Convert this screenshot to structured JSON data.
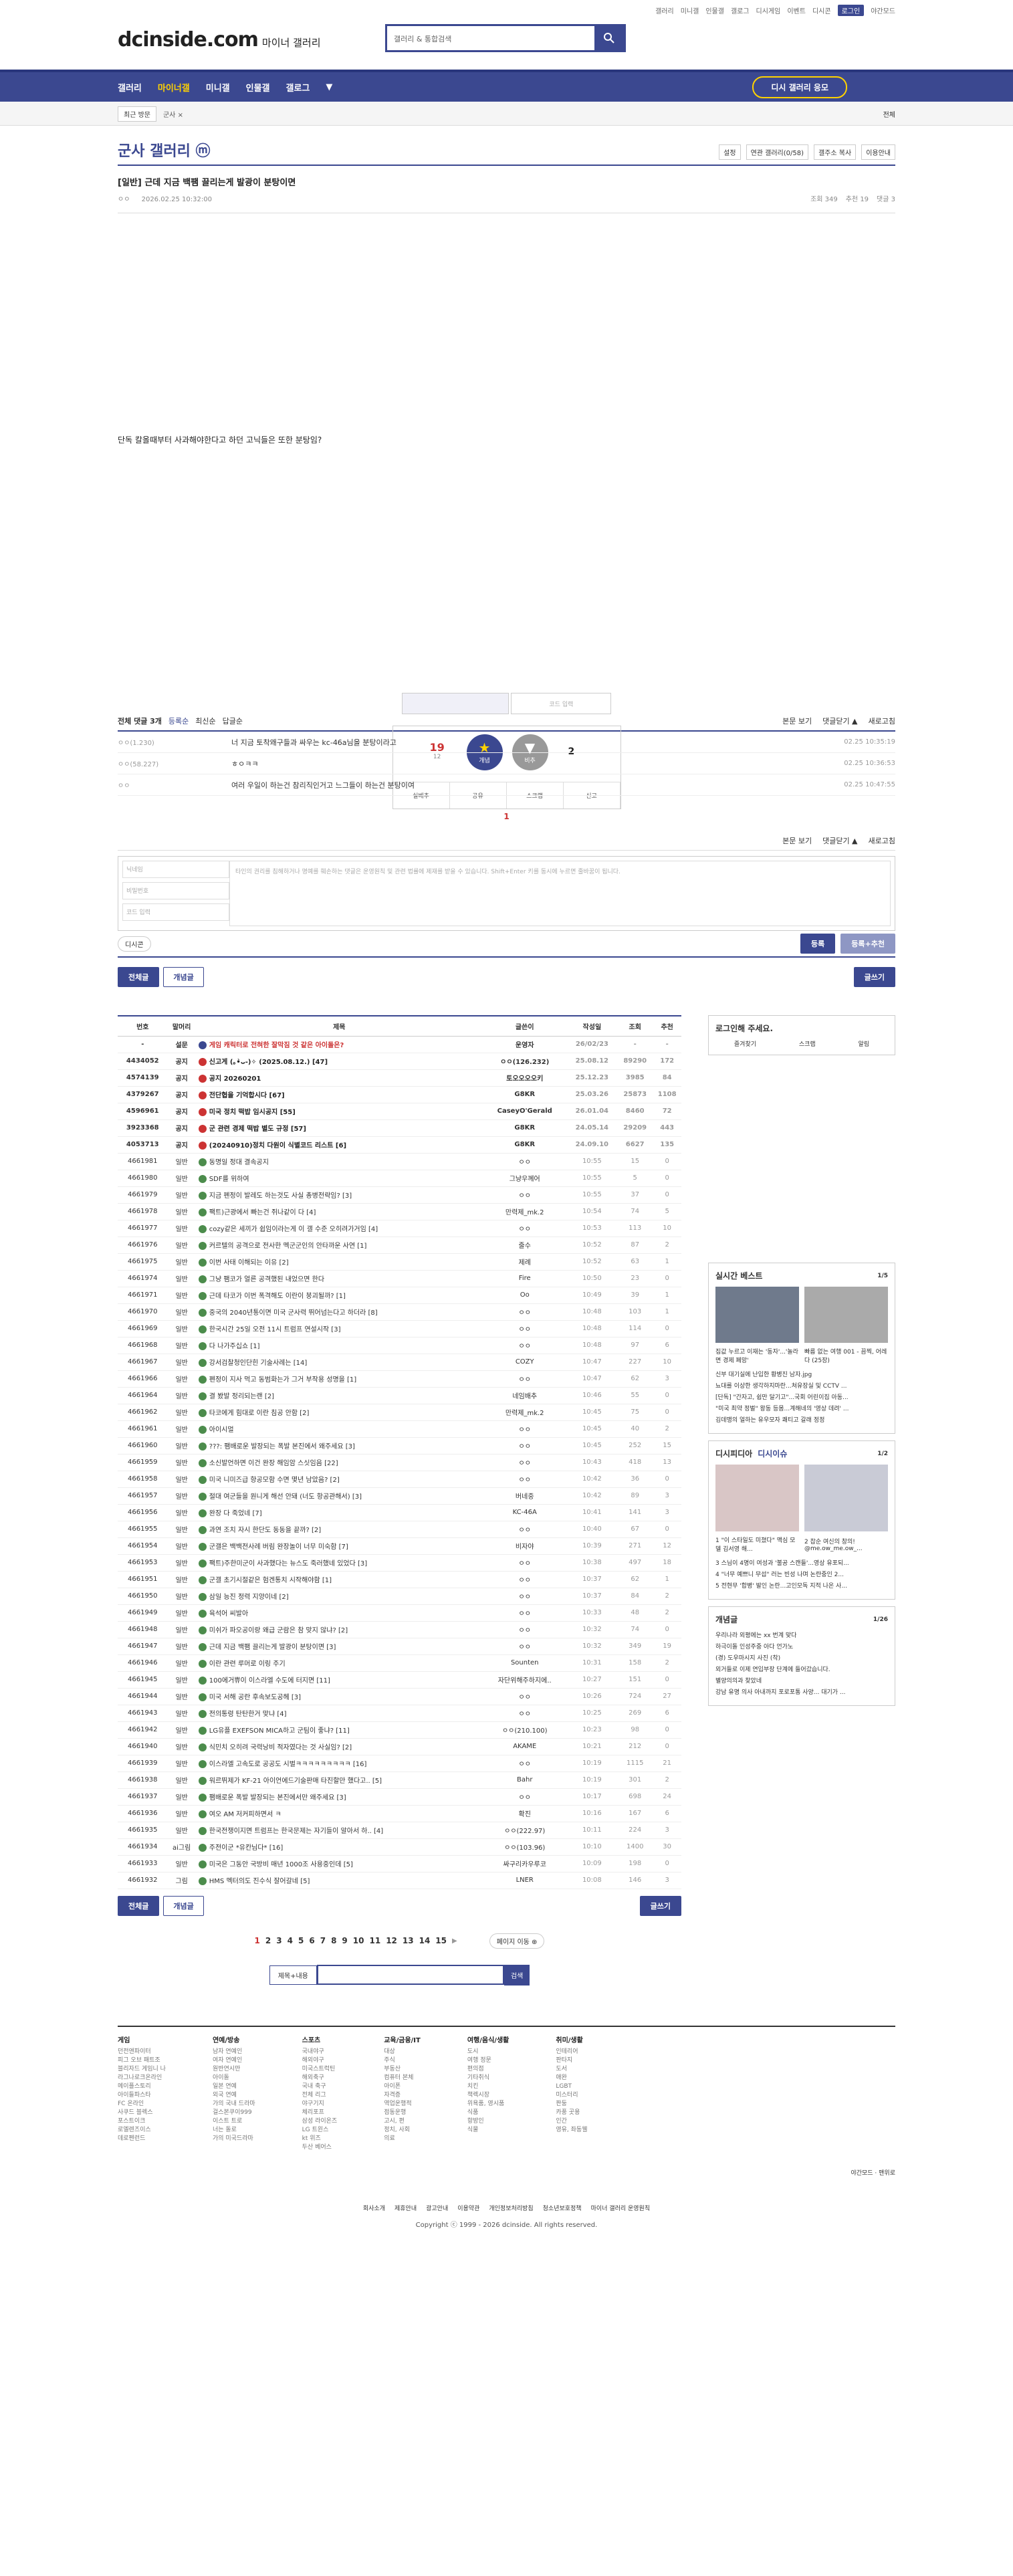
{
  "util_links": [
    "갤러리",
    "미니갤",
    "인물갤",
    "갤로그",
    "디시게임",
    "이벤트",
    "디시콘",
    "로그인",
    "야간모드"
  ],
  "header": {
    "logo": "dcinside.com",
    "logo_sub": "마이너 갤러리",
    "search_placeholder": "갤러리 & 통합검색"
  },
  "nav": {
    "items": [
      "갤러리",
      "마이너갤",
      "미니갤",
      "인물갤",
      "갤로그"
    ],
    "cta": "디시 갤러리 응모"
  },
  "recent": {
    "label": "최근 방문",
    "item": "군사 ×",
    "all": "전체"
  },
  "gallery": {
    "title": "군사 갤러리 ⓜ",
    "tools": [
      "설정",
      "연관 갤러리(0/58)",
      "갤주소 복사",
      "이용안내"
    ]
  },
  "post": {
    "title": "[일반] 근데 지금 백팸 끌리는게 발광이 분탕이면",
    "author": "ㅇㅇ",
    "date": "2026.02.25 10:32:00",
    "views": "조회 349",
    "reco": "추천 19",
    "comments": "댓글 3",
    "body": "단독 칼올때부터 사과해야한다고 하던 고닉들은 또한 분탕임?",
    "captcha_ph": "코드 입력",
    "up": "19",
    "up_fix": "12",
    "down": "2",
    "up_label": "개념",
    "down_label": "비추",
    "fn": [
      "실베추",
      "공유",
      "스크랩",
      "신고"
    ]
  },
  "comment": {
    "count": "전체 댓글 3개",
    "sort": [
      "등록순",
      "최신순",
      "답글순"
    ],
    "view": "본문 보기",
    "fold": "댓글닫기 ▲",
    "refresh": "새로고침",
    "list": [
      {
        "user": "ㅇㅇ(1.230)",
        "text": "너 지금 토착왜구들과 싸우는 kc-46a님을 분탕이라고",
        "time": "02.25 10:35:19"
      },
      {
        "user": "ㅇㅇ(58.227)",
        "text": "ㅎㅇㅋㅋ",
        "time": "02.25 10:36:53"
      },
      {
        "user": "ㅇㅇ",
        "text": "여러 우일이 하는건 참리직인거고 느그들이 하는건 분탕이여",
        "time": "02.25 10:47:55"
      }
    ],
    "page": "1",
    "nick_ph": "닉네임",
    "pw_ph": "비밀번호",
    "code_ph": "코드 입력",
    "text_ph": "타인의 권리를 침해하거나 명예를 훼손하는 댓글은 운영원칙 및 관련 법률에 제재를 받을 수 있습니다. Shift+Enter 키를 동시에 누르면 줄바꿈이 됩니다.",
    "dicon": "디시콘",
    "submit": "등록",
    "submit_reco": "등록+추천"
  },
  "list_tabs": {
    "all": "전체글",
    "concept": "개념글",
    "write": "글쓰기"
  },
  "table": {
    "cols": [
      "번호",
      "말머리",
      "제목",
      "글쓴이",
      "작성일",
      "조회",
      "추천"
    ],
    "rows": [
      [
        "-",
        "설문",
        "게임 캐릭터로 전혀한 잘막짐 것 같은 아이돌은?",
        "운영자",
        "26/02/23",
        "-",
        "-"
      ],
      [
        "4434052",
        "공지",
        "신고게 (｡•̀ᴗ-)✧ (2025.08.12.) [47]",
        "ㅇㅇ(126.232)",
        "25.08.12",
        "89290",
        "172"
      ],
      [
        "4574139",
        "공지",
        "공지 20260201",
        "토오오오오키",
        "25.12.23",
        "3985",
        "84"
      ],
      [
        "4379267",
        "공지",
        "전단협을 기억합시다 [67]",
        "G8KR",
        "25.03.26",
        "25873",
        "1108"
      ],
      [
        "4596961",
        "공지",
        "미국 정치 떡밥 임시공지 [55]",
        "CaseyO'Gerald",
        "26.01.04",
        "8460",
        "72"
      ],
      [
        "3923368",
        "공지",
        "군 관련 경제 떡밥 별도 규정 [57]",
        "G8KR",
        "24.05.14",
        "29209",
        "443"
      ],
      [
        "4053713",
        "공지",
        "(20240910)정치 다원이 식별코드 리스트 [6]",
        "G8KR",
        "24.09.10",
        "6627",
        "135"
      ],
      [
        "4661981",
        "일반",
        "동명일 정대 결속공지",
        "ㅇㅇ",
        "10:55",
        "15",
        "0"
      ],
      [
        "4661980",
        "일반",
        "SDF를 위하여",
        "그냥우께어",
        "10:55",
        "5",
        "0"
      ],
      [
        "4661979",
        "일반",
        "지금 펜정이 발레도 하는것도 사실 총병전략임? [3]",
        "ㅇㅇ",
        "10:55",
        "37",
        "0"
      ],
      [
        "4661978",
        "일반",
        "팩트)근광에서 빠는건 쥐나같이 다 [4]",
        "만력제_mk.2",
        "10:54",
        "74",
        "5"
      ],
      [
        "4661977",
        "일반",
        "cozy같은 세끼가 쉽임이라는게 이 갤 수준 오히려가거임 [4]",
        "ㅇㅇ",
        "10:53",
        "113",
        "10"
      ],
      [
        "4661976",
        "일반",
        "커르텔의 공격으로 전사한 멕군군인의 안타까운 사연 [1]",
        "줄수",
        "10:52",
        "87",
        "2"
      ],
      [
        "4661975",
        "일반",
        "이번 사태 이해되는 이유 [2]",
        "제례",
        "10:52",
        "63",
        "1"
      ],
      [
        "4661974",
        "일반",
        "그냥 팸코가 얼른 공격했된 내었으면 한다",
        "Fire",
        "10:50",
        "23",
        "0"
      ],
      [
        "4661971",
        "일반",
        "근데 타코가 이번 폭격해도 이란이 붕괴될까? [1]",
        "Oo",
        "10:49",
        "39",
        "1"
      ],
      [
        "4661970",
        "일반",
        "중국의 2040년통이면 미국 군사력 뛰어넘는다고 하더라 [8]",
        "ㅇㅇ",
        "10:48",
        "103",
        "1"
      ],
      [
        "4661969",
        "일반",
        "한국시간 25일 오전 11시 트럼프 연설시작 [3]",
        "ㅇㅇ",
        "10:48",
        "114",
        "0"
      ],
      [
        "4661968",
        "일반",
        "다 나가주십쇼 [1]",
        "ㅇㅇ",
        "10:48",
        "97",
        "6"
      ],
      [
        "4661967",
        "일반",
        "강서검찰청인단힌 기술사례는 [14]",
        "COZY",
        "10:47",
        "227",
        "10"
      ],
      [
        "4661966",
        "일반",
        "펜정이 지사 먹고 동범화는가 그거 부작용 성명을 [1]",
        "ㅇㅇ",
        "10:47",
        "62",
        "3"
      ],
      [
        "4661964",
        "일반",
        "결 봤발 정리되는랜 [2]",
        "네임배추",
        "10:46",
        "55",
        "0"
      ],
      [
        "4661962",
        "일반",
        "타코에게 힘대로 이란 침공 안함 [2]",
        "만력제_mk.2",
        "10:45",
        "75",
        "0"
      ],
      [
        "4661961",
        "일반",
        "아이시멀",
        "ㅇㅇ",
        "10:45",
        "40",
        "2"
      ],
      [
        "4661960",
        "일반",
        "???: 팸배로운 발장되는 폭발 본진에서 왜주세요 [3]",
        "ㅇㅇ",
        "10:45",
        "252",
        "15"
      ],
      [
        "4661959",
        "일반",
        "소신발언하면 이건 완장 해임암 스싯임음 [22]",
        "ㅇㅇ",
        "10:43",
        "418",
        "13"
      ],
      [
        "4661958",
        "일반",
        "미국 니미즈급 항공모함 수면 몇년 남았음? [2]",
        "ㅇㅇ",
        "10:42",
        "36",
        "0"
      ],
      [
        "4661957",
        "일반",
        "절대 여군들을 원니게 해선 안돼 (너도 항공관해서) [3]",
        "버네중",
        "10:42",
        "89",
        "3"
      ],
      [
        "4661956",
        "일반",
        "완장 다 죽었네 [7]",
        "KC-46A",
        "10:41",
        "141",
        "3"
      ],
      [
        "4661955",
        "일반",
        "과연 조치 자시 한단도 동동을 끝까? [2]",
        "ㅇㅇ",
        "10:40",
        "67",
        "0"
      ],
      [
        "4661954",
        "일반",
        "군갤은 백백전사례 버림 완장놀이 너무 미숙함 [7]",
        "비자야",
        "10:39",
        "271",
        "12"
      ],
      [
        "4661953",
        "일반",
        "팩트)주한미군이 사과했다는 뉴스도 죽러했네 있었다 [3]",
        "ㅇㅇ",
        "10:38",
        "497",
        "18"
      ],
      [
        "4661951",
        "일반",
        "군갤 초기시절같은 험겐통치 시작해야함 [1]",
        "ㅇㅇ",
        "10:37",
        "62",
        "1"
      ],
      [
        "4661950",
        "일반",
        "삼일 능진 정력 지양이네 [2]",
        "ㅇㅇ",
        "10:37",
        "84",
        "2"
      ],
      [
        "4661949",
        "일반",
        "육석어 씨발아",
        "ㅇㅇ",
        "10:33",
        "48",
        "2"
      ],
      [
        "4661948",
        "일반",
        "미쉬가 파오공이랑 왜급 군람은 참 맞지 않냐? [2]",
        "ㅇㅇ",
        "10:32",
        "74",
        "0"
      ],
      [
        "4661947",
        "일반",
        "근데 지금 백팸 끌리는게 발광이 분탕이면 [3]",
        "ㅇㅇ",
        "10:32",
        "349",
        "19"
      ],
      [
        "4661946",
        "일반",
        "이란 관련 루머로 이링 주기",
        "Sounten",
        "10:31",
        "158",
        "2"
      ],
      [
        "4661945",
        "일반",
        "100에거쀼이 이스라엘 수도에 터지면 [11]",
        "자단위해주하지에..",
        "10:27",
        "151",
        "0"
      ],
      [
        "4661944",
        "일반",
        "미국 서해 공란 후속보도공헤 [3]",
        "ㅇㅇ",
        "10:26",
        "724",
        "27"
      ],
      [
        "4661943",
        "일반",
        "전의통령 탄탄한거 맞냐 [4]",
        "ㅇㅇ",
        "10:25",
        "269",
        "6"
      ],
      [
        "4661942",
        "일반",
        "LG유플 EXEFSON MICA하고 군팀이 좋냐? [11]",
        "ㅇㅇ(210.100)",
        "10:23",
        "98",
        "0"
      ],
      [
        "4661940",
        "일반",
        "식민치 오히려 국력낭비 적자였다는 것 사실임? [2]",
        "AKAME",
        "10:21",
        "212",
        "0"
      ],
      [
        "4661939",
        "일반",
        "이스라엘 고속도로 공공도 시벌ㅋㅋㅋㅋㅋㅋㅋㅋㅋ [16]",
        "ㅇㅇ",
        "10:19",
        "1115",
        "21"
      ],
      [
        "4661938",
        "일반",
        "워르뛰제가 KF-21 아이언에드기술판매 타진할만 했다고.. [5]",
        "Bahr",
        "10:19",
        "301",
        "2"
      ],
      [
        "4661937",
        "일반",
        "팸배로운 폭발 발장되는 본진에서만 왜주세요 [3]",
        "ㅇㅇ",
        "10:17",
        "698",
        "24"
      ],
      [
        "4661936",
        "일반",
        "여오 AM 저커피하면서 ㅋ",
        "확진",
        "10:16",
        "167",
        "6"
      ],
      [
        "4661935",
        "일반",
        "한국전쟁이지면 트럼프는 한국문제는 자기들이 알아서 하.. [4]",
        "ㅇㅇ(222.97)",
        "10:11",
        "224",
        "3"
      ],
      [
        "4661934",
        "ai그림",
        "주전이군 *유칸님다* [16]",
        "ㅇㅇ(103.96)",
        "10:10",
        "1400",
        "30"
      ],
      [
        "4661933",
        "일반",
        "미국은 그동안 국방비 매년 1000조 사용중인데 [5]",
        "싸구리카우루코",
        "10:09",
        "198",
        "0"
      ],
      [
        "4661932",
        "그림",
        "HMS 멕터의도 진수식 잘어갈네 [5]",
        "LNER",
        "10:08",
        "146",
        "3"
      ]
    ]
  },
  "pager": {
    "pages": [
      "1",
      "2",
      "3",
      "4",
      "5",
      "6",
      "7",
      "8",
      "9",
      "10",
      "11",
      "12",
      "13",
      "14",
      "15"
    ],
    "move": "페이지 이동 ⊕"
  },
  "bottom_search": {
    "select": "제목+내용",
    "btn": "검색"
  },
  "side": {
    "login": "로그인해 주세요.",
    "login_btns": [
      "즐겨찾기",
      "스크랩",
      "알림"
    ],
    "best_title": "실시간 베스트",
    "best_page": "1/5",
    "best_caps": [
      "집값 누르고 이재는 '동자'...'놀라면 경제 폐망'",
      "빠름 없는 여행 001 - 끔찍, 어레다 (25장)"
    ],
    "best_list": [
      "신부 대기실에 난입한 황병진 남자.jpg",
      "뇨대를 이상한 생각하지마란...쳐유장실 및 CCTV ...",
      "[단독] \"간자고, 쉽만 달기고\"...국회 어린이집 아동...",
      "\"미국 최약 정벌\" 왕동 등몸...계해네의 '영상 데려' ...",
      "김데맹의 얼하는 유우모자 쾌티고 갈래 정정"
    ],
    "dc_title": "디시피디아",
    "dc_tab": "디시이슈",
    "dc_page": "1/2",
    "dc_caps": [
      "1 \"이 스타일도 미쳤다\" 맥심 모델 김서영 해...",
      "2 찹순 여신의 창의! @me.ow_me.ow_..."
    ],
    "dc_list": [
      "3 스님이 4명이 여성과 '불공 스캔들'...영상 유포되...",
      "4 \"너무 예쁘니 무섭\" 러는 빈성 나며 논란중인 2...",
      "5 전현무 '합병' 발인 논란...고인모독 지적 나온 사..."
    ],
    "gn_title": "개념글",
    "gn_page": "1/26",
    "gn_list": [
      "우리나라 외평에는 xx 번계 맞다",
      "하극이돌 인성주중 아다 언가노",
      "(경) 도우마시지 사진 (착)",
      "외거들로 이제 연입부장 단계에 들어갔습니다.",
      "별양의의과 찾았네",
      "강남 유명 의사 아내까지 포로포통 사양... 대기가 ..."
    ]
  },
  "footer": {
    "cols": [
      {
        "t": "게임",
        "items": [
          "던전앤파이터",
          "피그 오브 패트조",
          "블리자드 게임니 나",
          "라그나로크온라인",
          "메이플스토리",
          "아이들파스타",
          "FC 온라인",
          "사쿠드 블렉스",
          "포스트이크",
          "로엘렌즈이스",
          "데로펜런드"
        ]
      },
      {
        "t": "연예/방송",
        "items": [
          "남자 연예인",
          "여자 연예인",
          "원반연시만",
          "아이돌",
          "일본 연예",
          "외국 연예",
          "가의 국내 드라마",
          "걸스본쿠이999",
          "이스트 트로",
          "너는 돌로",
          "가의 미국드라마"
        ]
      },
      {
        "t": "스포츠",
        "items": [
          "국내야구",
          "해외야구",
          "미국스트럭틴",
          "해외축구",
          "국내 축구",
          "전체 리그",
          "야구기지",
          "체리포프",
          "삼성 라이온즈",
          "LG 트윈스",
          "kt 위즈",
          "두산 베어스"
        ]
      },
      {
        "t": "교육/금융/IT",
        "items": [
          "대상",
          "주식",
          "부동산",
          "컴퓨터 본체",
          "아이폰",
          "자격증",
          "역업운행적",
          "점동운행",
          "고시, 편",
          "정치, 사회",
          "의료"
        ]
      },
      {
        "t": "여행/음식/생활",
        "items": [
          "도시",
          "여행 정문",
          "편의점",
          "기타취식",
          "치킨",
          "책렉시장",
          "위욕품, 영시품",
          "식품",
          "항방인",
          "식물"
        ]
      },
      {
        "t": "취미/생활",
        "items": [
          "인테리어",
          "판타지",
          "도서",
          "애완",
          "LGBT",
          "미스터리",
          "판둥",
          "카풍 곳용",
          "인간",
          "영유, 좌동웰"
        ]
      }
    ],
    "links": [
      "회사소개",
      "제휴안내",
      "광고안내",
      "이용약관",
      "개인정보처리방침",
      "청소년보호정책",
      "마이너 갤러리 운영원칙"
    ],
    "copyright": "Copyright ⓒ 1999 - 2026 dcinside. All rights reserved.",
    "mode": [
      "야간모드",
      "맨위로"
    ]
  }
}
